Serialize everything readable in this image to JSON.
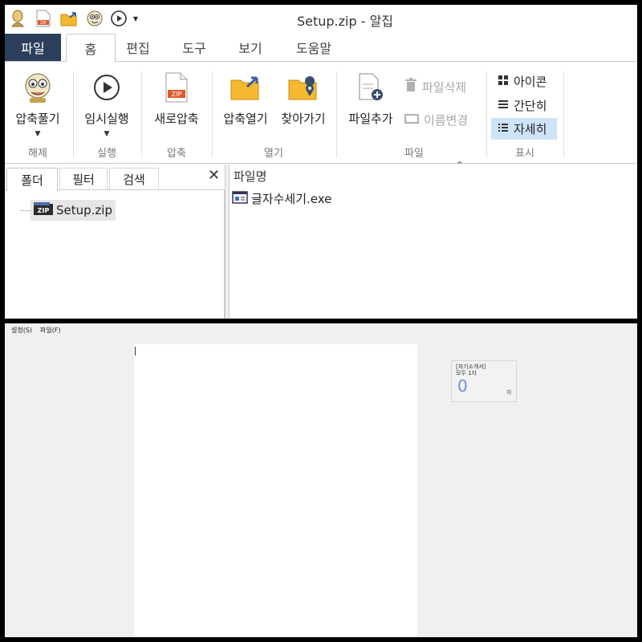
{
  "alzip": {
    "title": "Setup.zip - 알집",
    "quick_access": [
      "user-icon",
      "zip-file-icon",
      "folder-open-icon",
      "alzip-mascot-icon",
      "play-icon"
    ],
    "quick_dropdown": "▾",
    "tabs": [
      {
        "label": "파일"
      },
      {
        "label": "홈"
      },
      {
        "label": "편집"
      },
      {
        "label": "도구"
      },
      {
        "label": "보기"
      },
      {
        "label": "도움말"
      }
    ],
    "groups": {
      "release": {
        "label": "해제",
        "btn_extract": "압축풀기"
      },
      "run": {
        "label": "실행",
        "btn_temp_run": "임시실행"
      },
      "compress": {
        "label": "압축",
        "btn_new": "새로압축"
      },
      "open": {
        "label": "열기",
        "btn_open": "압축열기",
        "btn_goto": "찾아가기"
      },
      "file": {
        "label": "파일",
        "btn_add": "파일추가",
        "btn_delete": "파일삭제",
        "btn_rename": "이름변경"
      },
      "display": {
        "label": "표시",
        "btn_icon": "아이콘",
        "btn_simple": "간단히",
        "btn_detail": "자세히"
      }
    },
    "left_tabs": [
      {
        "label": "폴더"
      },
      {
        "label": "필터"
      },
      {
        "label": "검색"
      }
    ],
    "close_glyph": "✕",
    "tree": {
      "item": "Setup.zip"
    },
    "file_list": {
      "column_name": "파일명",
      "sort_glyph": "⌃",
      "rows": [
        {
          "name": "글자수세기.exe"
        }
      ]
    },
    "colors": {
      "file_tab_bg": "#2b3f5c",
      "selected_bg": "#cde3f7"
    }
  },
  "counter": {
    "menu": [
      "설정(S)",
      "파일(F)"
    ],
    "editor_text": "",
    "stat": {
      "title_line1": "[자기소개서]",
      "title_line2": "모두 1자",
      "value": "0",
      "unit": "자"
    },
    "colors": {
      "value": "#6f93c9"
    }
  }
}
